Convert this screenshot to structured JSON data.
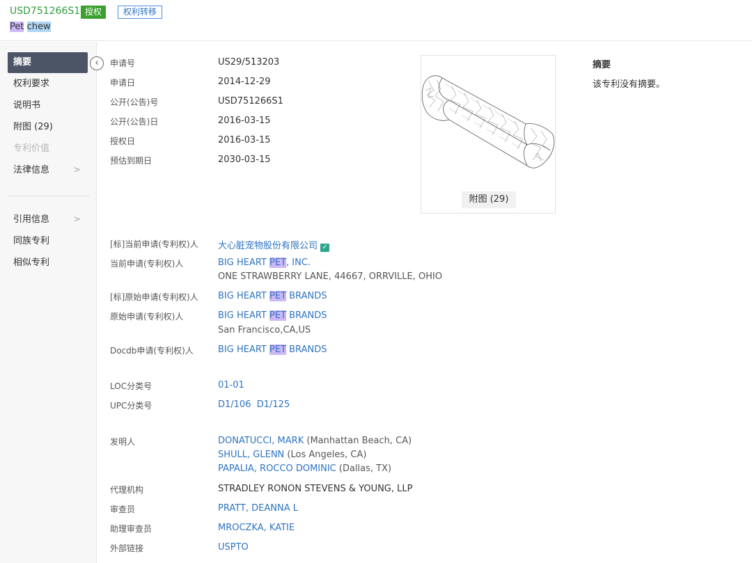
{
  "header": {
    "pub_no": "USD751266S1",
    "badge_granted": "授权",
    "badge_transfer": "权利转移",
    "title_word1": "Pet",
    "title_word2": "chew"
  },
  "sidebar": {
    "collapse_icon": "chevron-left",
    "items": [
      {
        "label": "摘要"
      },
      {
        "label": "权利要求"
      },
      {
        "label": "说明书"
      },
      {
        "label": "附图 (29)"
      },
      {
        "label": "专利价值"
      },
      {
        "label": "法律信息",
        "chevron": ">"
      },
      {
        "label": "引用信息",
        "chevron": ">"
      },
      {
        "label": "同族专利"
      },
      {
        "label": "相似专利"
      }
    ]
  },
  "fields": {
    "app_no": {
      "label": "申请号",
      "value": "US29/513203"
    },
    "app_date": {
      "label": "申请日",
      "value": "2014-12-29"
    },
    "pub_no": {
      "label": "公开(公告)号",
      "value": "USD751266S1"
    },
    "pub_date": {
      "label": "公开(公告)日",
      "value": "2016-03-15"
    },
    "grant_date": {
      "label": "授权日",
      "value": "2016-03-15"
    },
    "expiry_date": {
      "label": "预估到期日",
      "value": "2030-03-15"
    },
    "std_current_applicant": {
      "label": "[标]当前申请(专利权)人",
      "value": "大心脏宠物股份有限公司"
    },
    "current_applicant": {
      "label": "当前申请(专利权)人",
      "pre": "BIG HEART ",
      "hl": "PET",
      "post": ", INC.",
      "address": "ONE STRAWBERRY LANE, 44667, ORRVILLE, OHIO"
    },
    "std_original_applicant": {
      "label": "[标]原始申请(专利权)人",
      "pre": "BIG HEART ",
      "hl": "PET",
      "post": " BRANDS"
    },
    "original_applicant": {
      "label": "原始申请(专利权)人",
      "pre": "BIG HEART ",
      "hl": "PET",
      "post": " BRANDS",
      "address": "San Francisco,CA,US"
    },
    "docdb_applicant": {
      "label": "Docdb申请(专利权)人",
      "pre": "BIG HEART ",
      "hl": "PET",
      "post": " BRANDS"
    },
    "loc": {
      "label": "LOC分类号",
      "value": "01-01"
    },
    "upc": {
      "label": "UPC分类号",
      "values": [
        "D1/106",
        "D1/125"
      ]
    },
    "inventors": {
      "label": "发明人",
      "list": [
        {
          "name": "DONATUCCI, MARK",
          "loc": "(Manhattan Beach, CA)"
        },
        {
          "name": "SHULL, GLENN",
          "loc": "(Los Angeles, CA)"
        },
        {
          "name": "PAPALIA, ROCCO DOMINIC",
          "loc": "(Dallas, TX)"
        }
      ]
    },
    "agency": {
      "label": "代理机构",
      "value": "STRADLEY RONON STEVENS & YOUNG, LLP"
    },
    "examiner": {
      "label": "审查员",
      "value": "PRATT, DEANNA L"
    },
    "asst_examiner": {
      "label": "助理审查员",
      "value": "MROCZKA, KATIE"
    },
    "external_link": {
      "label": "外部链接",
      "value": "USPTO"
    }
  },
  "figure": {
    "button_label": "附图 (29)"
  },
  "abstract": {
    "title": "摘要",
    "text": "该专利没有摘要。"
  }
}
